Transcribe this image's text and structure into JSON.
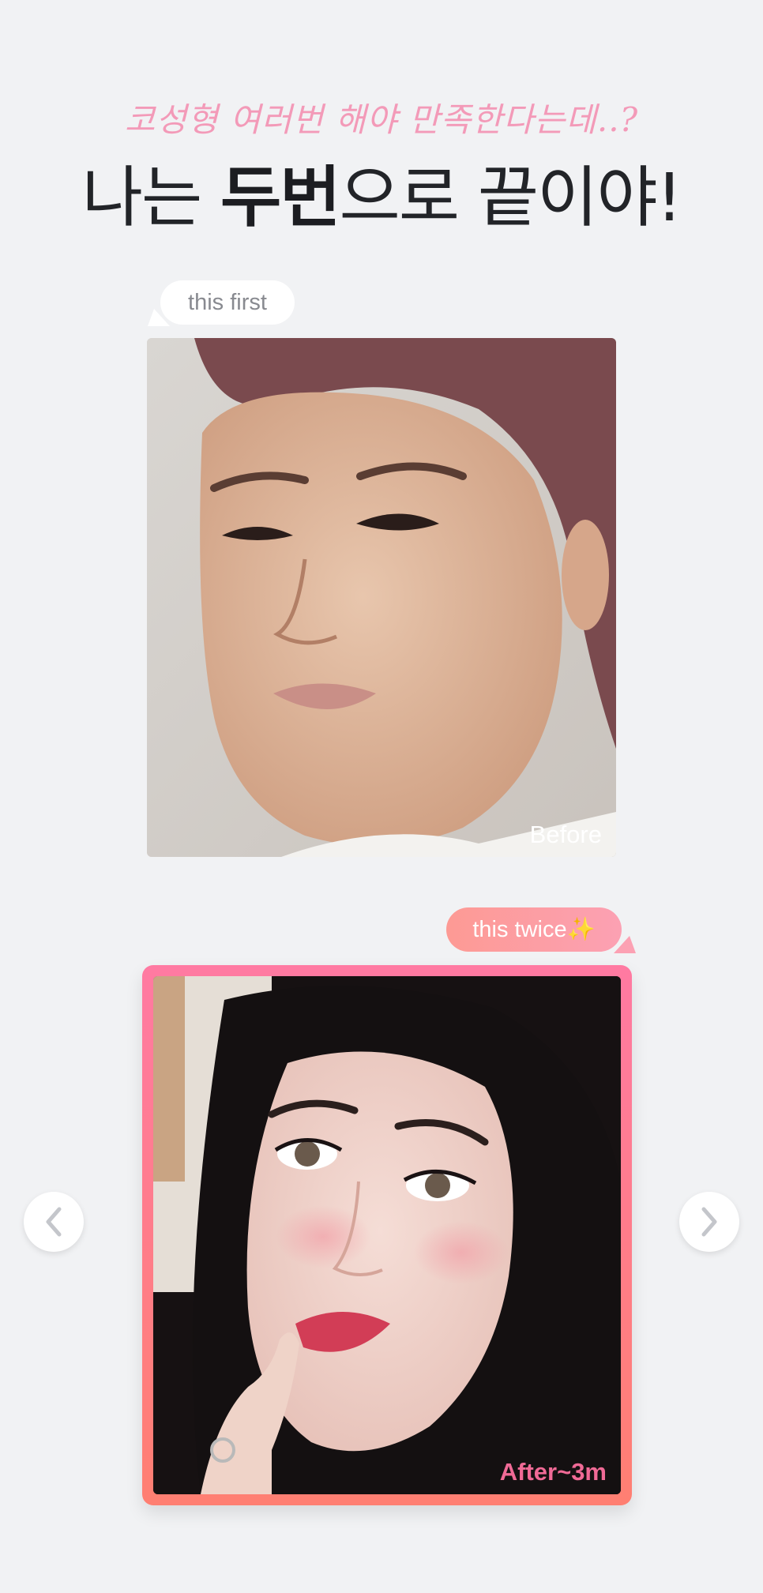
{
  "header": {
    "subtitle": "코성형 여러번 해야 만족한다는데..?",
    "headline_prefix": "나는 ",
    "headline_bold": "두번",
    "headline_suffix": "으로 끝이야!"
  },
  "before": {
    "bubble_label": "this first",
    "photo_label": "Before"
  },
  "after": {
    "bubble_label": "this twice",
    "bubble_emoji": "✨",
    "photo_label": "After~3m"
  },
  "carousel": {
    "prev_icon": "chevron-left-icon",
    "next_icon": "chevron-right-icon"
  },
  "colors": {
    "background": "#f1f2f4",
    "accent_pink": "#f06a96",
    "subtitle_pink": "#f39ab8",
    "frame_gradient_start": "#ff7aa2",
    "frame_gradient_end": "#ff7f72"
  }
}
